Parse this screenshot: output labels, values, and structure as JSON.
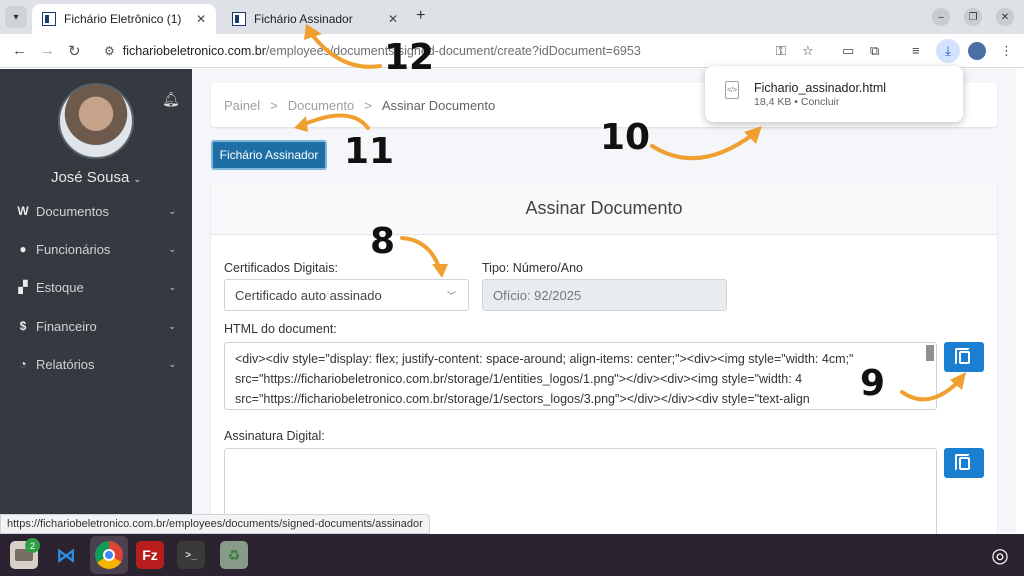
{
  "browser": {
    "tabs": [
      {
        "title": "Fichário Eletrônico (1)",
        "active": true
      },
      {
        "title": "Fichário Assinador",
        "active": false
      }
    ],
    "url_host": "fichariobeletronico.com.br",
    "url_path": "/employees/documents/signed-document/create?idDocument=6953",
    "download": {
      "filename": "Fichario_assinador.html",
      "meta": "18,4 KB • Concluir"
    }
  },
  "sidebar": {
    "user_name": "José Sousa",
    "items": [
      {
        "label": "Documentos",
        "icon": "file-w-icon"
      },
      {
        "label": "Funcionários",
        "icon": "user-icon"
      },
      {
        "label": "Estoque",
        "icon": "boxes-icon"
      },
      {
        "label": "Financeiro",
        "icon": "dollar-icon"
      },
      {
        "label": "Relatórios",
        "icon": "pie-chart-icon"
      }
    ]
  },
  "breadcrumb": [
    "Painel",
    "Documento",
    "Assinar Documento"
  ],
  "assinador_button": "Fichário Assinador",
  "form": {
    "title": "Assinar Documento",
    "cert_label": "Certificados Digitais:",
    "cert_value": "Certificado auto assinado",
    "type_label": "Tipo: Número/Ano",
    "type_value": "Ofício: 92/2025",
    "html_label": "HTML do document:",
    "html_lines": [
      "<div><div style=\"display: flex; justify-content: space-around; align-items: center;\"><div><img style=\"width: 4cm;\"",
      "src=\"https://fichariobeletronico.com.br/storage/1/entities_logos/1.png\"></div><div><img style=\"width: 4",
      "src=\"https://fichariobeletronico.com.br/storage/1/sectors_logos/3.png\"></div></div><div style=\"text-align"
    ],
    "signature_label": "Assinatura Digital:"
  },
  "status_url": "https://fichariobeletronico.com.br/employees/documents/signed-documents/assinador",
  "annotations": [
    "8",
    "9",
    "10",
    "11",
    "12"
  ],
  "taskbar": {
    "files_badge": "2"
  },
  "colors": {
    "accent": "#1a7fd1",
    "sidebar": "#343a40",
    "annotation_arrow": "#f0a030"
  }
}
